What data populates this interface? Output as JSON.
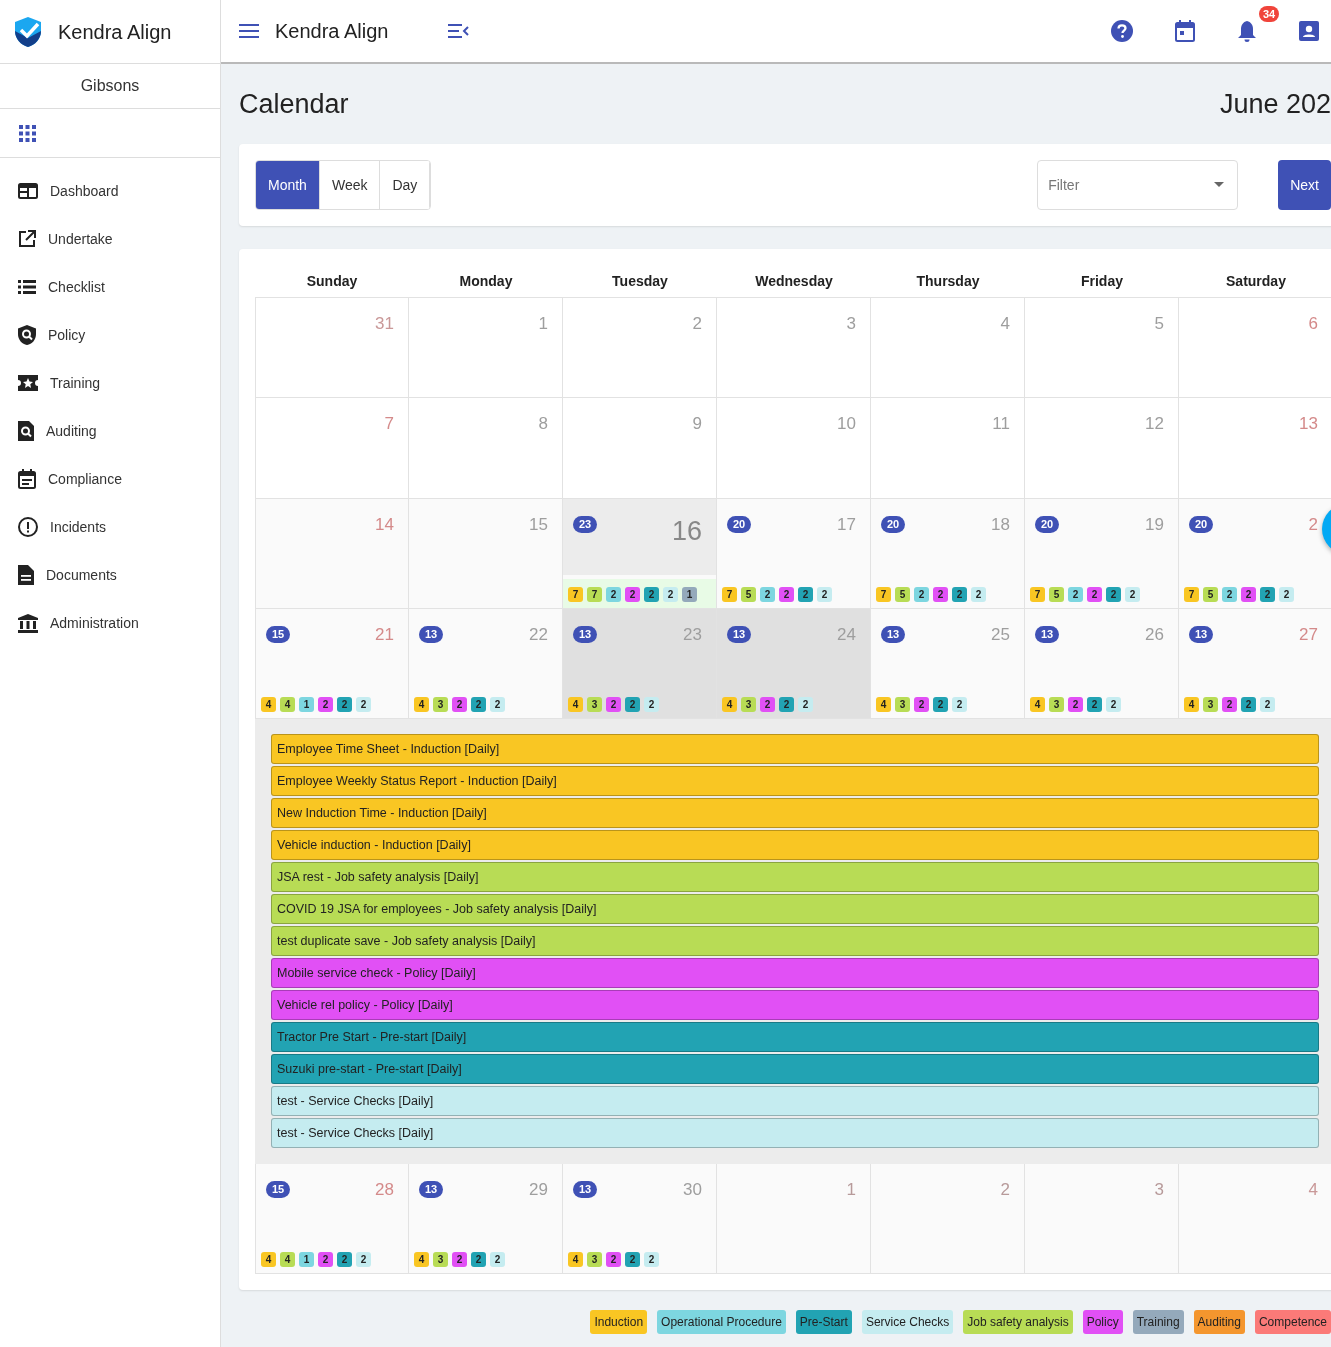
{
  "brand": {
    "name": "Kendra Align"
  },
  "sidebar": {
    "site": "Gibsons",
    "items": [
      {
        "label": "Dashboard"
      },
      {
        "label": "Undertake"
      },
      {
        "label": "Checklist"
      },
      {
        "label": "Policy"
      },
      {
        "label": "Training"
      },
      {
        "label": "Auditing"
      },
      {
        "label": "Compliance"
      },
      {
        "label": "Incidents"
      },
      {
        "label": "Documents"
      },
      {
        "label": "Administration"
      }
    ]
  },
  "topbar": {
    "title": "Kendra Align",
    "notifications": "34"
  },
  "page": {
    "title": "Calendar",
    "period": "June 202"
  },
  "view_tabs": [
    {
      "label": "Month",
      "selected": true
    },
    {
      "label": "Week",
      "selected": false
    },
    {
      "label": "Day",
      "selected": false
    }
  ],
  "filter": {
    "placeholder": "Filter"
  },
  "next_button": "Next",
  "weekdays": [
    "Sunday",
    "Monday",
    "Tuesday",
    "Wednesday",
    "Thursday",
    "Friday",
    "Saturday"
  ],
  "weeks": [
    {
      "days": [
        {
          "date": "31",
          "weekend": true,
          "other_month": true,
          "selected": false,
          "shaded": false
        },
        {
          "date": "1",
          "weekend": false,
          "other_month": false,
          "selected": false,
          "shaded": false
        },
        {
          "date": "2",
          "weekend": false,
          "other_month": false,
          "selected": false,
          "shaded": false
        },
        {
          "date": "3",
          "weekend": false,
          "other_month": false,
          "selected": false,
          "shaded": false
        },
        {
          "date": "4",
          "weekend": false,
          "other_month": false,
          "selected": false,
          "shaded": false
        },
        {
          "date": "5",
          "weekend": false,
          "other_month": false,
          "selected": false,
          "shaded": false
        },
        {
          "date": "6",
          "weekend": true,
          "other_month": false,
          "selected": false,
          "shaded": false
        }
      ]
    },
    {
      "days": [
        {
          "date": "7",
          "weekend": true,
          "other_month": false,
          "selected": false,
          "shaded": false
        },
        {
          "date": "8",
          "weekend": false,
          "other_month": false,
          "selected": false,
          "shaded": false
        },
        {
          "date": "9",
          "weekend": false,
          "other_month": false,
          "selected": false,
          "shaded": false
        },
        {
          "date": "10",
          "weekend": false,
          "other_month": false,
          "selected": false,
          "shaded": false
        },
        {
          "date": "11",
          "weekend": false,
          "other_month": false,
          "selected": false,
          "shaded": false
        },
        {
          "date": "12",
          "weekend": false,
          "other_month": false,
          "selected": false,
          "shaded": false
        },
        {
          "date": "13",
          "weekend": true,
          "other_month": false,
          "selected": false,
          "shaded": false
        }
      ]
    },
    {
      "days": [
        {
          "date": "14",
          "weekend": true,
          "other_month": false,
          "selected": false,
          "shaded": false
        },
        {
          "date": "15",
          "weekend": false,
          "other_month": false,
          "selected": false,
          "shaded": false
        },
        {
          "date": "16",
          "weekend": false,
          "other_month": false,
          "selected": true,
          "shaded": false,
          "count": "23",
          "badges": [
            {
              "value": "7",
              "color": "#f9c623"
            },
            {
              "value": "7",
              "color": "#b8dc55"
            },
            {
              "value": "2",
              "color": "#7dd6e0"
            },
            {
              "value": "2",
              "color": "#e150f5"
            },
            {
              "value": "2",
              "color": "#22a3b3"
            },
            {
              "value": "2",
              "color": "#c5ecf0"
            },
            {
              "value": "1",
              "color": "#94a9bb"
            }
          ]
        },
        {
          "date": "17",
          "weekend": false,
          "other_month": false,
          "selected": false,
          "shaded": false,
          "count": "20",
          "badges": [
            {
              "value": "7",
              "color": "#f9c623"
            },
            {
              "value": "5",
              "color": "#b8dc55"
            },
            {
              "value": "2",
              "color": "#7dd6e0"
            },
            {
              "value": "2",
              "color": "#e150f5"
            },
            {
              "value": "2",
              "color": "#22a3b3"
            },
            {
              "value": "2",
              "color": "#c5ecf0"
            }
          ]
        },
        {
          "date": "18",
          "weekend": false,
          "other_month": false,
          "selected": false,
          "shaded": false,
          "count": "20",
          "badges": [
            {
              "value": "7",
              "color": "#f9c623"
            },
            {
              "value": "5",
              "color": "#b8dc55"
            },
            {
              "value": "2",
              "color": "#7dd6e0"
            },
            {
              "value": "2",
              "color": "#e150f5"
            },
            {
              "value": "2",
              "color": "#22a3b3"
            },
            {
              "value": "2",
              "color": "#c5ecf0"
            }
          ]
        },
        {
          "date": "19",
          "weekend": false,
          "other_month": false,
          "selected": false,
          "shaded": false,
          "count": "20",
          "badges": [
            {
              "value": "7",
              "color": "#f9c623"
            },
            {
              "value": "5",
              "color": "#b8dc55"
            },
            {
              "value": "2",
              "color": "#7dd6e0"
            },
            {
              "value": "2",
              "color": "#e150f5"
            },
            {
              "value": "2",
              "color": "#22a3b3"
            },
            {
              "value": "2",
              "color": "#c5ecf0"
            }
          ]
        },
        {
          "date": "2",
          "weekend": true,
          "other_month": false,
          "selected": false,
          "shaded": false,
          "count": "20",
          "badges": [
            {
              "value": "7",
              "color": "#f9c623"
            },
            {
              "value": "5",
              "color": "#b8dc55"
            },
            {
              "value": "2",
              "color": "#7dd6e0"
            },
            {
              "value": "2",
              "color": "#e150f5"
            },
            {
              "value": "2",
              "color": "#22a3b3"
            },
            {
              "value": "2",
              "color": "#c5ecf0"
            }
          ]
        }
      ]
    },
    {
      "days": [
        {
          "date": "21",
          "weekend": true,
          "other_month": false,
          "selected": false,
          "shaded": false,
          "count": "15",
          "badges": [
            {
              "value": "4",
              "color": "#f9c623"
            },
            {
              "value": "4",
              "color": "#b8dc55"
            },
            {
              "value": "1",
              "color": "#7dd6e0"
            },
            {
              "value": "2",
              "color": "#e150f5"
            },
            {
              "value": "2",
              "color": "#22a3b3"
            },
            {
              "value": "2",
              "color": "#c5ecf0"
            }
          ]
        },
        {
          "date": "22",
          "weekend": false,
          "other_month": false,
          "selected": false,
          "shaded": false,
          "count": "13",
          "badges": [
            {
              "value": "4",
              "color": "#f9c623"
            },
            {
              "value": "3",
              "color": "#b8dc55"
            },
            {
              "value": "2",
              "color": "#e150f5"
            },
            {
              "value": "2",
              "color": "#22a3b3"
            },
            {
              "value": "2",
              "color": "#c5ecf0"
            }
          ]
        },
        {
          "date": "23",
          "weekend": false,
          "other_month": false,
          "selected": false,
          "shaded": true,
          "count": "13",
          "badges": [
            {
              "value": "4",
              "color": "#f9c623"
            },
            {
              "value": "3",
              "color": "#b8dc55"
            },
            {
              "value": "2",
              "color": "#e150f5"
            },
            {
              "value": "2",
              "color": "#22a3b3"
            },
            {
              "value": "2",
              "color": "#c5ecf0"
            }
          ]
        },
        {
          "date": "24",
          "weekend": false,
          "other_month": false,
          "selected": false,
          "shaded": true,
          "count": "13",
          "badges": [
            {
              "value": "4",
              "color": "#f9c623"
            },
            {
              "value": "3",
              "color": "#b8dc55"
            },
            {
              "value": "2",
              "color": "#e150f5"
            },
            {
              "value": "2",
              "color": "#22a3b3"
            },
            {
              "value": "2",
              "color": "#c5ecf0"
            }
          ]
        },
        {
          "date": "25",
          "weekend": false,
          "other_month": false,
          "selected": false,
          "shaded": false,
          "count": "13",
          "badges": [
            {
              "value": "4",
              "color": "#f9c623"
            },
            {
              "value": "3",
              "color": "#b8dc55"
            },
            {
              "value": "2",
              "color": "#e150f5"
            },
            {
              "value": "2",
              "color": "#22a3b3"
            },
            {
              "value": "2",
              "color": "#c5ecf0"
            }
          ]
        },
        {
          "date": "26",
          "weekend": false,
          "other_month": false,
          "selected": false,
          "shaded": false,
          "count": "13",
          "badges": [
            {
              "value": "4",
              "color": "#f9c623"
            },
            {
              "value": "3",
              "color": "#b8dc55"
            },
            {
              "value": "2",
              "color": "#e150f5"
            },
            {
              "value": "2",
              "color": "#22a3b3"
            },
            {
              "value": "2",
              "color": "#c5ecf0"
            }
          ]
        },
        {
          "date": "27",
          "weekend": true,
          "other_month": false,
          "selected": false,
          "shaded": false,
          "count": "13",
          "badges": [
            {
              "value": "4",
              "color": "#f9c623"
            },
            {
              "value": "3",
              "color": "#b8dc55"
            },
            {
              "value": "2",
              "color": "#e150f5"
            },
            {
              "value": "2",
              "color": "#22a3b3"
            },
            {
              "value": "2",
              "color": "#c5ecf0"
            }
          ]
        }
      ],
      "events": [
        {
          "label": "Employee Time Sheet - Induction [Daily]",
          "color": "#f9c623"
        },
        {
          "label": "Employee Weekly Status Report - Induction [Daily]",
          "color": "#f9c623"
        },
        {
          "label": "New Induction Time - Induction [Daily]",
          "color": "#f9c623"
        },
        {
          "label": "Vehicle induction - Induction [Daily]",
          "color": "#f9c623"
        },
        {
          "label": "JSA rest - Job safety analysis [Daily]",
          "color": "#b8dc55"
        },
        {
          "label": "COVID 19 JSA for employees - Job safety analysis [Daily]",
          "color": "#b8dc55"
        },
        {
          "label": "test duplicate save - Job safety analysis [Daily]",
          "color": "#b8dc55"
        },
        {
          "label": "Mobile service check - Policy [Daily]",
          "color": "#e150f5"
        },
        {
          "label": "Vehicle rel policy - Policy [Daily]",
          "color": "#e150f5"
        },
        {
          "label": "Tractor Pre Start - Pre-start [Daily]",
          "color": "#22a3b3"
        },
        {
          "label": "Suzuki pre-start - Pre-start [Daily]",
          "color": "#22a3b3"
        },
        {
          "label": "test - Service Checks [Daily]",
          "color": "#c5ecf0"
        },
        {
          "label": "test - Service Checks [Daily]",
          "color": "#c5ecf0"
        }
      ]
    },
    {
      "days": [
        {
          "date": "28",
          "weekend": true,
          "other_month": false,
          "selected": false,
          "shaded": false,
          "count": "15",
          "badges": [
            {
              "value": "4",
              "color": "#f9c623"
            },
            {
              "value": "4",
              "color": "#b8dc55"
            },
            {
              "value": "1",
              "color": "#7dd6e0"
            },
            {
              "value": "2",
              "color": "#e150f5"
            },
            {
              "value": "2",
              "color": "#22a3b3"
            },
            {
              "value": "2",
              "color": "#c5ecf0"
            }
          ]
        },
        {
          "date": "29",
          "weekend": false,
          "other_month": false,
          "selected": false,
          "shaded": false,
          "count": "13",
          "badges": [
            {
              "value": "4",
              "color": "#f9c623"
            },
            {
              "value": "3",
              "color": "#b8dc55"
            },
            {
              "value": "2",
              "color": "#e150f5"
            },
            {
              "value": "2",
              "color": "#22a3b3"
            },
            {
              "value": "2",
              "color": "#c5ecf0"
            }
          ]
        },
        {
          "date": "30",
          "weekend": false,
          "other_month": false,
          "selected": false,
          "shaded": false,
          "count": "13",
          "badges": [
            {
              "value": "4",
              "color": "#f9c623"
            },
            {
              "value": "3",
              "color": "#b8dc55"
            },
            {
              "value": "2",
              "color": "#e150f5"
            },
            {
              "value": "2",
              "color": "#22a3b3"
            },
            {
              "value": "2",
              "color": "#c5ecf0"
            }
          ]
        },
        {
          "date": "1",
          "weekend": false,
          "other_month": true,
          "selected": false,
          "shaded": false
        },
        {
          "date": "2",
          "weekend": false,
          "other_month": true,
          "selected": false,
          "shaded": false
        },
        {
          "date": "3",
          "weekend": false,
          "other_month": true,
          "selected": false,
          "shaded": false
        },
        {
          "date": "4",
          "weekend": true,
          "other_month": true,
          "selected": false,
          "shaded": false
        }
      ]
    }
  ],
  "legend": [
    {
      "label": "Induction",
      "color": "#f9c623"
    },
    {
      "label": "Operational Procedure",
      "color": "#7dd6e0"
    },
    {
      "label": "Pre-Start",
      "color": "#22a3b3"
    },
    {
      "label": "Service Checks",
      "color": "#c5ecf0"
    },
    {
      "label": "Job safety analysis",
      "color": "#b8dc55"
    },
    {
      "label": "Policy",
      "color": "#e150f5"
    },
    {
      "label": "Training",
      "color": "#94a9bb"
    },
    {
      "label": "Auditing",
      "color": "#f4962e"
    },
    {
      "label": "Competence",
      "color": "#fb7a78"
    }
  ]
}
